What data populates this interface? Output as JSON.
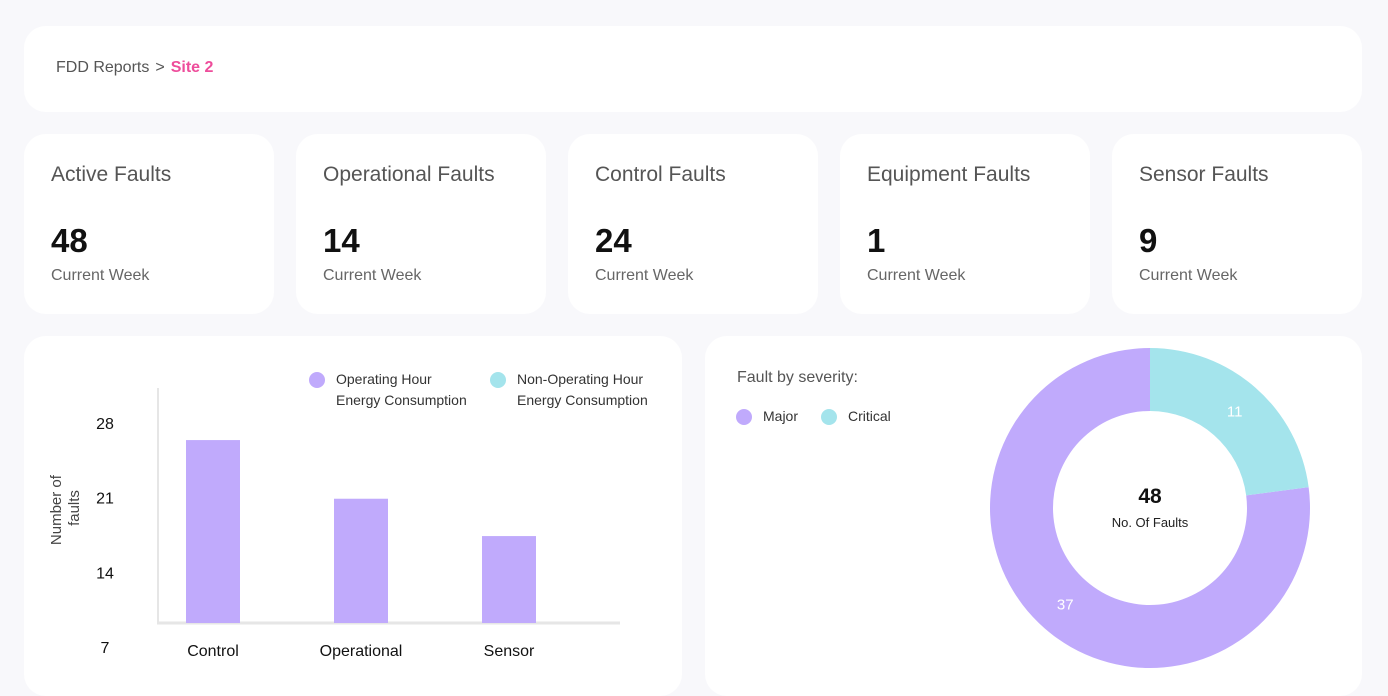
{
  "breadcrumb": {
    "root": "FDD Reports",
    "separator": ">",
    "current": "Site 2"
  },
  "stats": [
    {
      "title": "Active Faults",
      "value": "48",
      "sub": "Current Week"
    },
    {
      "title": "Operational Faults",
      "value": "14",
      "sub": "Current Week"
    },
    {
      "title": "Control Faults",
      "value": "24",
      "sub": "Current Week"
    },
    {
      "title": "Equipment Faults",
      "value": "1",
      "sub": "Current Week"
    },
    {
      "title": "Sensor Faults",
      "value": "9",
      "sub": "Current Week"
    }
  ],
  "colors": {
    "accent": "#ee4d9b",
    "purple": "#c0aafc",
    "cyan": "#a4e4ec"
  },
  "chart_data": [
    {
      "type": "bar",
      "categories": [
        "Control",
        "Operational",
        "Sensor"
      ],
      "series": [
        {
          "name": "Operating Hour Energy Consumption",
          "values": [
            26.4,
            20.9,
            17.4
          ]
        }
      ],
      "legend": [
        {
          "line1": "Operating Hour",
          "line2": "Energy Consumption",
          "color": "#c0aafc"
        },
        {
          "line1": "Non-Operating Hour",
          "line2": "Energy Consumption",
          "color": "#a4e4ec"
        }
      ],
      "ylabel_line1": "Number of",
      "ylabel_line2": "faults",
      "yticks": [
        7,
        14,
        21,
        28
      ],
      "ylim": [
        7,
        28
      ],
      "legend_position": "top-right",
      "grid": false
    },
    {
      "type": "pie",
      "title": "Fault by severity:",
      "categories": [
        "Major",
        "Critical"
      ],
      "values": [
        37,
        11
      ],
      "colors": [
        "#c0aafc",
        "#a4e4ec"
      ],
      "center_value": "48",
      "center_label": "No. Of Faults",
      "legend_position": "top-left"
    }
  ]
}
